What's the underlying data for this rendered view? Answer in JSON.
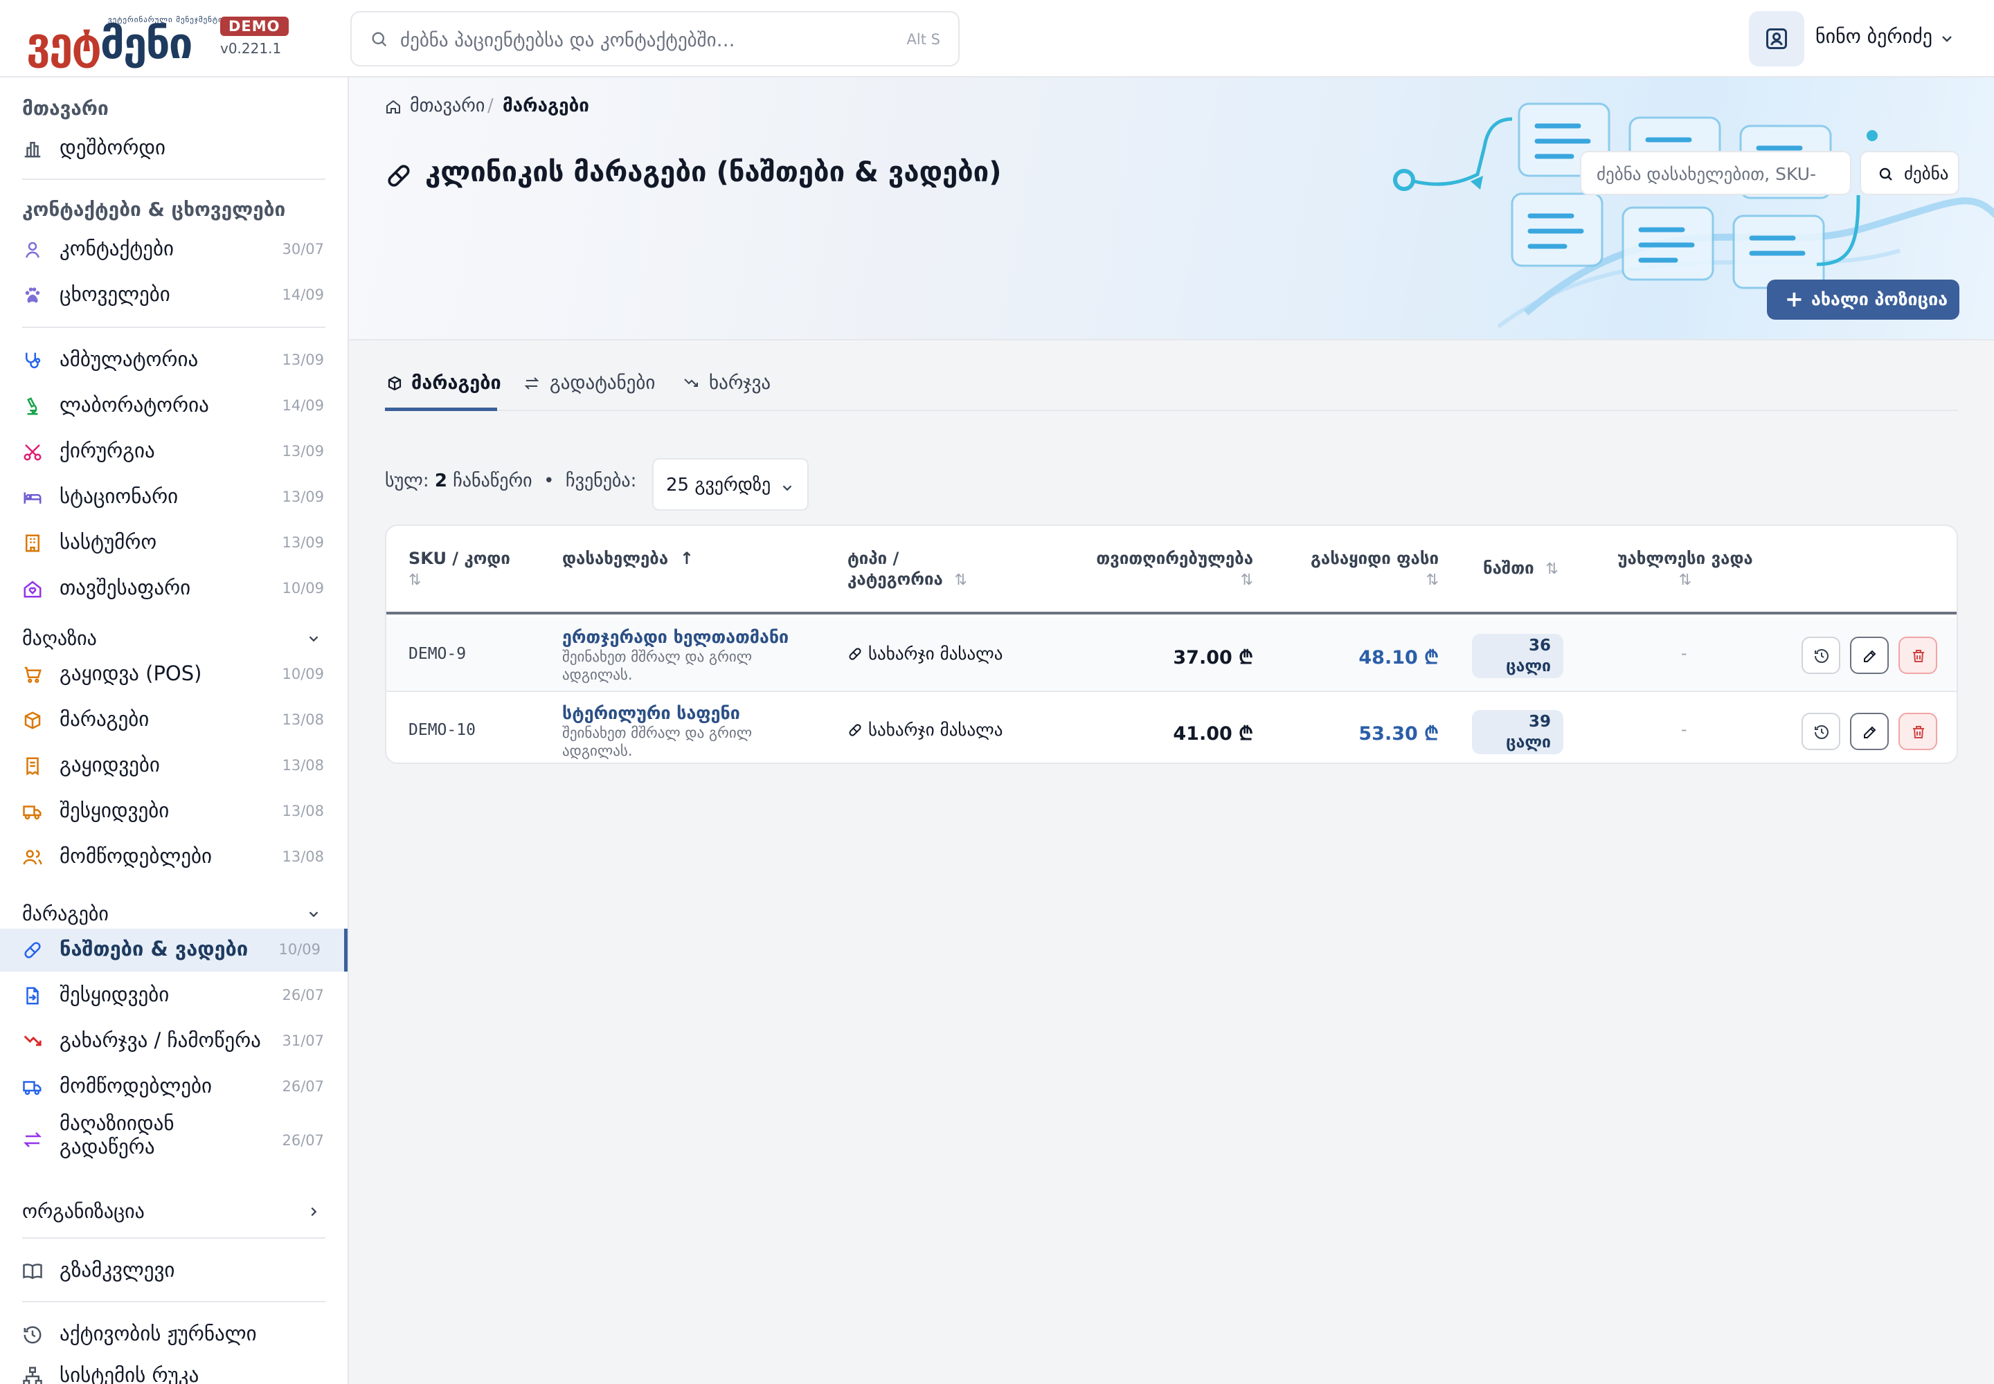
{
  "app": {
    "logo_tagline": "ვეტერინარული მენეჯმენტი",
    "logo_text_a": "ვეტ",
    "logo_text_b": "მენი",
    "badge": "DEMO",
    "version": "v0.221.1"
  },
  "header": {
    "search_placeholder": "ძებნა პაციენტებსა და კონტაქტებში…",
    "search_shortcut": "Alt S",
    "user_name": "ნინო ბერიძე"
  },
  "sidebar": {
    "main_title": "მთავარი",
    "dashboard": "დეშბორდი",
    "contacts_title": "კონტაქტები & ცხოველები",
    "contacts": {
      "label": "კონტაქტები",
      "date": "30/07"
    },
    "animals": {
      "label": "ცხოველები",
      "date": "14/09"
    },
    "ambulatory": {
      "label": "ამბულატორია",
      "date": "13/09"
    },
    "laboratory": {
      "label": "ლაბორატორია",
      "date": "14/09"
    },
    "surgery": {
      "label": "ქირურგია",
      "date": "13/09"
    },
    "stationary": {
      "label": "სტაციონარი",
      "date": "13/09"
    },
    "hotel": {
      "label": "სასტუმრო",
      "date": "13/09"
    },
    "shelter": {
      "label": "თავშესაფარი",
      "date": "10/09"
    },
    "shop_title": "მაღაზია",
    "pos": {
      "label": "გაყიდვა (POS)",
      "date": "10/09"
    },
    "shop_stock": {
      "label": "მარაგები",
      "date": "13/08"
    },
    "sales": {
      "label": "გაყიდვები",
      "date": "13/08"
    },
    "shop_purchases": {
      "label": "შესყიდვები",
      "date": "13/08"
    },
    "shop_suppliers": {
      "label": "მომწოდებლები",
      "date": "13/08"
    },
    "stock_title": "მარაგები",
    "balances": {
      "label": "ნაშთები & ვადები",
      "date": "10/09"
    },
    "purchases": {
      "label": "შესყიდვები",
      "date": "26/07"
    },
    "writeoff": {
      "label": "გახარჯვა / ჩამოწერა",
      "date": "31/07"
    },
    "suppliers": {
      "label": "მომწოდებლები",
      "date": "26/07"
    },
    "transfer": {
      "label": "მაღაზიიდან გადაწერა",
      "date": "26/07"
    },
    "org_title": "ორგანიზაცია",
    "guide": "გზამკვლევი",
    "activity_log": "აქტივობის ჟურნალი",
    "system_map": "სისტემის რუკა"
  },
  "page": {
    "breadcrumb_home": "მთავარი",
    "breadcrumb_current": "მარაგები",
    "title": "კლინიკის მარაგები (ნაშთები & ვადები)",
    "search_placeholder": "ძებნა დასახელებით, SKU-",
    "search_button": "ძებნა",
    "new_button": "ახალი პოზიცია"
  },
  "tabs": [
    {
      "label": "მარაგები",
      "active": true
    },
    {
      "label": "გადატანები",
      "active": false
    },
    {
      "label": "ხარჯვა",
      "active": false
    }
  ],
  "summary": {
    "total_prefix": "სულ:",
    "total_count": "2",
    "total_suffix": "ჩანაწერი",
    "bullet": "•",
    "show_label": "ჩვენება:",
    "page_size": "25 გვერდზე"
  },
  "table": {
    "columns": {
      "sku": "SKU / კოდი",
      "name": "დასახელება",
      "type_1": "ტიპი /",
      "type_2": "კატეგორია",
      "cost": "თვითღირებულება",
      "price": "გასაყიდი ფასი",
      "stock": "ნაშთი",
      "expiry": "უახლოესი ვადა"
    },
    "rows": [
      {
        "sku": "DEMO-9",
        "name": "ერთჯერადი ხელთათმანი",
        "note": "შეინახეთ მშრალ და გრილ ადგილას.",
        "type": "სახარჯი მასალა",
        "cost": "37.00 ₾",
        "price": "48.10 ₾",
        "stock_qty": "36",
        "stock_unit": "ცალი",
        "expiry": "-"
      },
      {
        "sku": "DEMO-10",
        "name": "სტერილური საფენი",
        "note": "შეინახეთ მშრალ და გრილ ადგილას.",
        "type": "სახარჯი მასალა",
        "cost": "41.00 ₾",
        "price": "53.30 ₾",
        "stock_qty": "39",
        "stock_unit": "ცალი",
        "expiry": "-"
      }
    ]
  },
  "colors": {
    "accent": "#3b5f9a",
    "link": "#2b4f86",
    "price": "#2b5ea8",
    "danger": "#d14343",
    "brand_red": "#c0392b"
  }
}
